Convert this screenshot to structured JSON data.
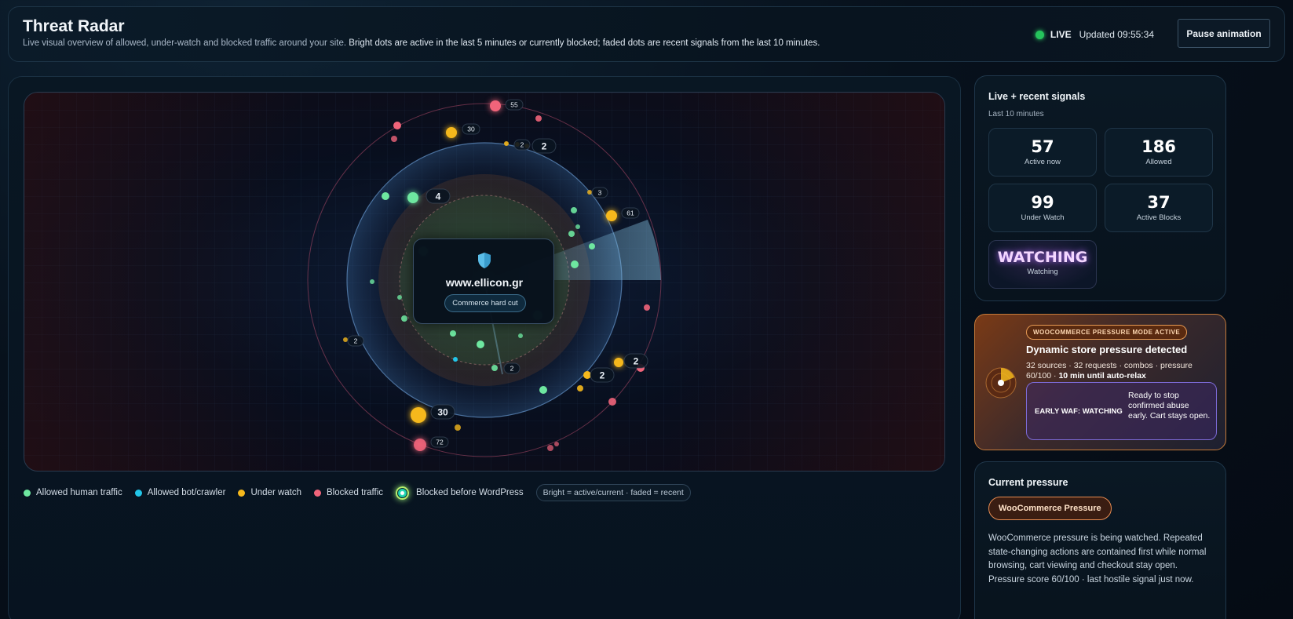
{
  "header": {
    "title": "Threat Radar",
    "subtitle_plain": "Live visual overview of allowed, under-watch and blocked traffic around your site.",
    "subtitle_emph": " Bright dots are active in the last 5 minutes or currently blocked; faded dots are recent signals from the last 10 minutes.",
    "live_label": "LIVE",
    "updated": "Updated 09:55:34",
    "pause_label": "Pause animation"
  },
  "radar": {
    "site": "www.ellicon.gr",
    "mode": "Commerce hard cut",
    "badges": {
      "b55": "55",
      "b30top": "30",
      "b2a": "2",
      "b2b": "2",
      "b4": "4",
      "b3": "3",
      "b61": "61",
      "b2left": "2",
      "b2center": "2",
      "b2right1": "2",
      "b2right2": "2",
      "b30bottom": "30",
      "b72": "72"
    }
  },
  "legend": {
    "human": "Allowed human traffic",
    "bot": "Allowed bot/crawler",
    "watch": "Under watch",
    "blocked": "Blocked traffic",
    "blocked_wp": "Blocked before WordPress",
    "note": "Bright = active/current · faded = recent"
  },
  "colors": {
    "human": "#6ee7a0",
    "bot": "#22c5e8",
    "watch": "#f5b81c",
    "blocked": "#f0647a",
    "live": "#25c45c"
  },
  "signals": {
    "title": "Live + recent signals",
    "sub": "Last 10 minutes",
    "stats": [
      {
        "num": "57",
        "label": "Active now"
      },
      {
        "num": "186",
        "label": "Allowed"
      },
      {
        "num": "99",
        "label": "Under Watch"
      },
      {
        "num": "37",
        "label": "Active Blocks"
      }
    ],
    "watch_state": "WATCHING",
    "watch_label": "Watching"
  },
  "woo": {
    "badge": "WOOCOMMERCE PRESSURE MODE ACTIVE",
    "title": "Dynamic store pressure detected",
    "desc_a": "32 sources · 32 requests · combos · pressure 60/100 · ",
    "desc_b": "10 min until auto-relax",
    "waf_label": "EARLY WAF: WATCHING",
    "waf_text": "Ready to stop confirmed abuse early. Cart stays open."
  },
  "pressure": {
    "title": "Current pressure",
    "pill": "WooCommerce Pressure",
    "text": "WooCommerce pressure is being watched. Repeated state-changing actions are contained first while normal browsing, cart viewing and checkout stay open. Pressure score 60/100 · last hostile signal just now."
  }
}
